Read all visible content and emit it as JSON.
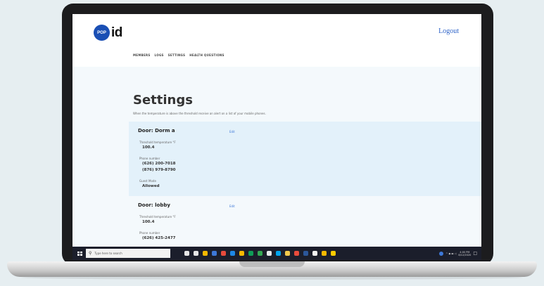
{
  "header": {
    "logo_badge": "POP",
    "logo_text": "id",
    "logout_label": "Logout"
  },
  "nav": {
    "items": [
      "MEMBERS",
      "LOGS",
      "SETTINGS",
      "HEALTH QUESTIONS"
    ]
  },
  "page": {
    "title": "Settings",
    "subtitle": "When the temperature is above the threshold receive an alert on a list of your mobile phones."
  },
  "doors": [
    {
      "name": "Door: Dorm a",
      "edit_label": "Edit",
      "threshold_label": "Threshold temperature °F",
      "threshold_value": "100.4",
      "phone_label": "Phone number",
      "phones": [
        "(626) 200-7018",
        "(876) 979-8790"
      ],
      "guest_label": "Guest Mode",
      "guest_value": "Allowed"
    },
    {
      "name": "Door: lobby",
      "edit_label": "Edit",
      "threshold_label": "Threshold temperature °F",
      "threshold_value": "100.4",
      "phone_label": "Phone number",
      "phones": [
        "(626) 425-2477"
      ]
    }
  ],
  "taskbar": {
    "search_placeholder": "Type here to search",
    "time": "4:00 PM",
    "date": "8/12/2020",
    "app_colors": [
      "#e6e6e6",
      "#e6e6e6",
      "#f5b800",
      "#3d78d8",
      "#e84b3c",
      "#1e88e5",
      "#f5b800",
      "#0f9d58",
      "#34a853",
      "#e8eaed",
      "#00a4ef",
      "#f2c94c",
      "#e84b3c",
      "#2b579a",
      "#f2f2f2",
      "#f5b800",
      "#ffcc00"
    ]
  },
  "colors": {
    "accent": "#2d63c8",
    "brand": "#1a4fb4",
    "door_highlight": "#e3f1fa"
  }
}
